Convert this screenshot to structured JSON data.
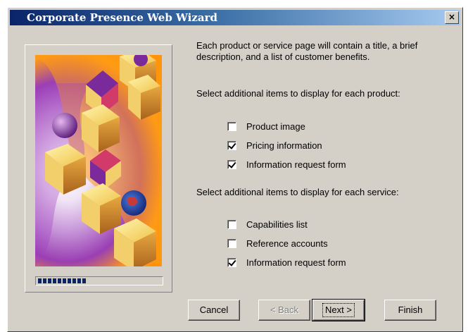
{
  "window": {
    "title": "Corporate Presence Web Wizard",
    "close_label": "×"
  },
  "intro_text": "Each product or service page will contain a title, a brief description, and a list of customer benefits.",
  "product_section": {
    "label": "Select additional items to display for each product:",
    "items": [
      {
        "label": "Product image",
        "checked": false
      },
      {
        "label": "Pricing information",
        "checked": true
      },
      {
        "label": "Information request form",
        "checked": true
      }
    ]
  },
  "service_section": {
    "label": "Select additional items to display for each service:",
    "items": [
      {
        "label": "Capabilities list",
        "checked": false
      },
      {
        "label": "Reference accounts",
        "checked": false
      },
      {
        "label": "Information request form",
        "checked": true
      }
    ]
  },
  "progress": {
    "fraction": 0.42
  },
  "buttons": {
    "cancel": "Cancel",
    "back": "< Back",
    "next": "Next >",
    "finish": "Finish"
  },
  "colors": {
    "title_bar_start": "#0a246a",
    "dialog_face": "#d4d0c8",
    "art_orange": "#ff8a00",
    "art_purple": "#9a3fb3"
  }
}
